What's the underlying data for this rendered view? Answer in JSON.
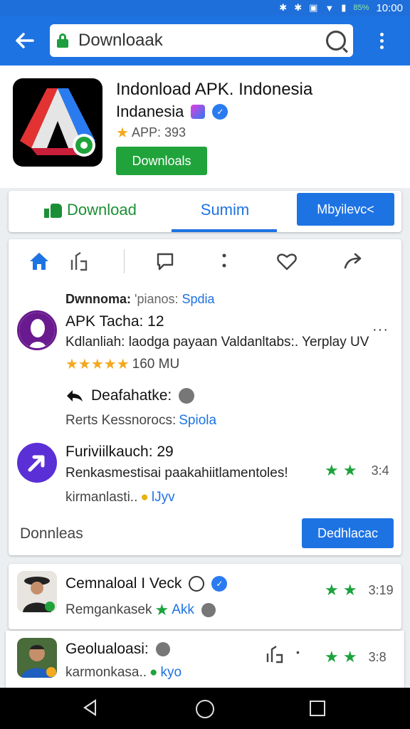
{
  "status": {
    "time": "10:00",
    "battery": "85%"
  },
  "toolbar": {
    "url": "Downloaak"
  },
  "app": {
    "name": "Indonload APK. Indonesia",
    "subtitle": "Indanesia",
    "rating_label": "APP: 393",
    "download_button": "Downloals"
  },
  "tabs": {
    "download": "Download",
    "summary": "Sumim",
    "action": "Mbyilevc<"
  },
  "card": {
    "meta": {
      "label": "Dwnnoma:",
      "value": "'pianos:",
      "link": "Spdia"
    },
    "item1": {
      "title": "APK Tacha: 12",
      "text": "Kdlanliah: laodga payaan Valdanltabs:. Yerplay UV",
      "size": "160 MU"
    },
    "item2": {
      "title": "Deafahatke:",
      "sub_label": "Rerts Kessnorocs:",
      "sub_link": "Spiola"
    },
    "item3": {
      "title": "Furiviilkauch: 29",
      "text": "Renkasmestisai paakahiitlamentoles!",
      "rating": "3:4",
      "sub": "kirmanlasti..",
      "sub_link": "lJyv"
    },
    "footer_label": "Donnleas",
    "footer_button": "Dedhlacac"
  },
  "list": [
    {
      "title": "Cemnaloal I Veck",
      "sub": "Remgankasek",
      "sub_link": "Akk",
      "rating": "3:19"
    },
    {
      "title": "Geolualoasi:",
      "sub": "karmonkasa..",
      "sub_link": "kyo",
      "rating": "3:8"
    }
  ],
  "colors": {
    "primary": "#1e73e3",
    "green": "#1fa33a",
    "star": "#f2a91e"
  },
  "icons": [
    "back-arrow-icon",
    "lock-icon",
    "reload-icon",
    "more-vert-icon",
    "home-icon",
    "share-icon",
    "comment-icon",
    "heart-icon",
    "forward-icon"
  ]
}
